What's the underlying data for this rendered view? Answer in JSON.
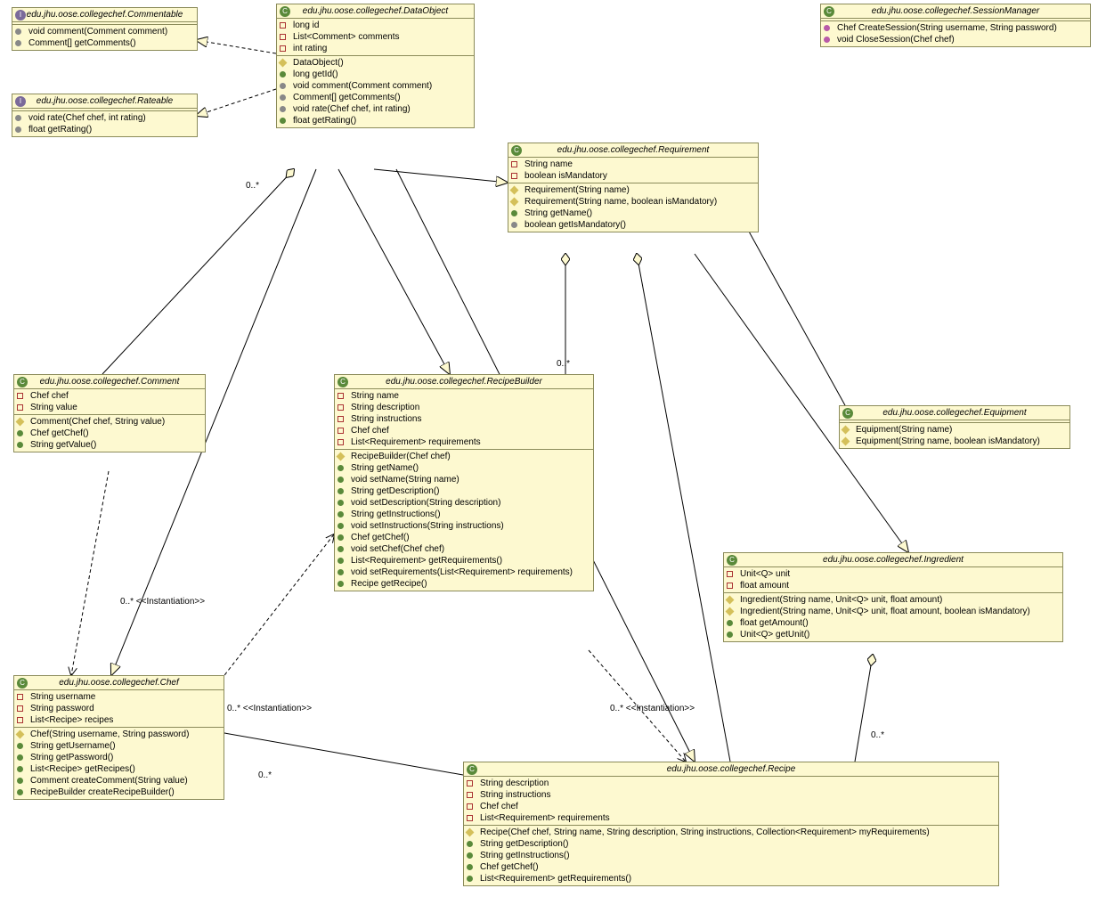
{
  "classes": {
    "commentable": {
      "title": "edu.jhu.oose.collegechef.Commentable",
      "m": [
        "void comment(Comment comment)",
        "Comment[] getComments()"
      ]
    },
    "rateable": {
      "title": "edu.jhu.oose.collegechef.Rateable",
      "m": [
        "void rate(Chef chef, int rating)",
        "float getRating()"
      ]
    },
    "dataobject": {
      "title": "edu.jhu.oose.collegechef.DataObject",
      "f": [
        "long id",
        "List<Comment> comments",
        "int rating"
      ],
      "m": [
        "DataObject()",
        "long getId()",
        "void comment(Comment comment)",
        "Comment[] getComments()",
        "void rate(Chef chef, int rating)",
        "float getRating()"
      ]
    },
    "sessionmanager": {
      "title": "edu.jhu.oose.collegechef.SessionManager",
      "m": [
        "Chef CreateSession(String username, String password)",
        "void CloseSession(Chef chef)"
      ]
    },
    "requirement": {
      "title": "edu.jhu.oose.collegechef.Requirement",
      "f": [
        "String name",
        "boolean isMandatory"
      ],
      "m": [
        "Requirement(String name)",
        "Requirement(String name, boolean isMandatory)",
        "String getName()",
        "boolean getIsMandatory()"
      ]
    },
    "comment": {
      "title": "edu.jhu.oose.collegechef.Comment",
      "f": [
        "Chef chef",
        "String value"
      ],
      "m": [
        "Comment(Chef chef, String value)",
        "Chef getChef()",
        "String getValue()"
      ]
    },
    "recipebuilder": {
      "title": "edu.jhu.oose.collegechef.RecipeBuilder",
      "f": [
        "String name",
        "String description",
        "String instructions",
        "Chef chef",
        "List<Requirement> requirements"
      ],
      "m": [
        "RecipeBuilder(Chef chef)",
        "String getName()",
        "void setName(String name)",
        "String getDescription()",
        "void setDescription(String description)",
        "String getInstructions()",
        "void setInstructions(String instructions)",
        "Chef getChef()",
        "void setChef(Chef chef)",
        "List<Requirement> getRequirements()",
        "void setRequirements(List<Requirement> requirements)",
        "Recipe getRecipe()"
      ]
    },
    "equipment": {
      "title": "edu.jhu.oose.collegechef.Equipment",
      "m": [
        "Equipment(String name)",
        "Equipment(String name, boolean isMandatory)"
      ]
    },
    "ingredient": {
      "title": "edu.jhu.oose.collegechef.Ingredient",
      "f": [
        "Unit<Q> unit",
        "float amount"
      ],
      "m": [
        "Ingredient(String name, Unit<Q> unit, float amount)",
        "Ingredient(String name, Unit<Q> unit, float amount, boolean isMandatory)",
        "float getAmount()",
        "Unit<Q> getUnit()"
      ]
    },
    "chef": {
      "title": "edu.jhu.oose.collegechef.Chef",
      "f": [
        "String username",
        "String password",
        "List<Recipe> recipes"
      ],
      "m": [
        "Chef(String username, String password)",
        "String getUsername()",
        "String getPassword()",
        "List<Recipe> getRecipes()",
        "Comment createComment(String value)",
        "RecipeBuilder createRecipeBuilder()"
      ]
    },
    "recipe": {
      "title": "edu.jhu.oose.collegechef.Recipe",
      "f": [
        "String description",
        "String instructions",
        "Chef chef",
        "List<Requirement> requirements"
      ],
      "m": [
        "Recipe(Chef chef, String name, String description, String instructions, Collection<Requirement> myRequirements)",
        "String getDescription()",
        "String getInstructions()",
        "Chef getChef()",
        "List<Requirement> getRequirements()"
      ]
    }
  },
  "labels": {
    "l1": "0..*",
    "l2": "0..* <<Instantiation>>",
    "l3": "0..* <<Instantiation>>",
    "l4": "0..* <<Instantiation>>",
    "l5": "0..*",
    "l6": "0..*",
    "l7": "0..*"
  }
}
